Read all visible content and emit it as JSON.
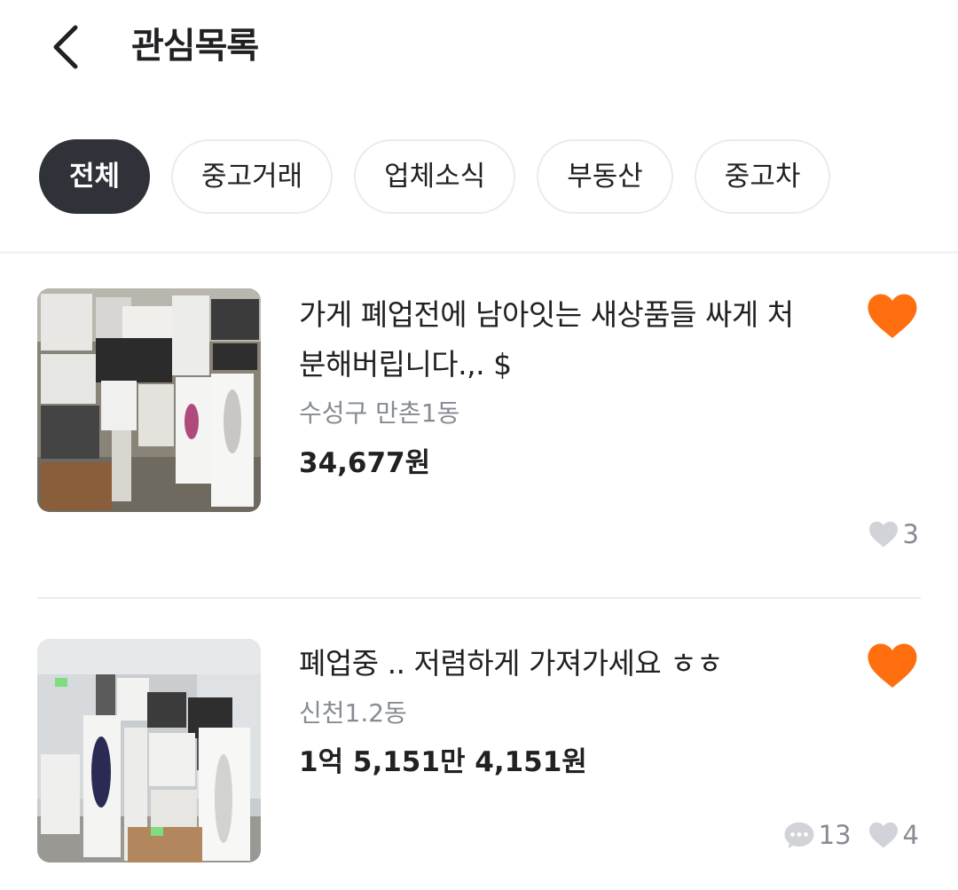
{
  "header": {
    "title": "관심목록",
    "back_icon": "chevron-left-icon"
  },
  "filters": [
    {
      "label": "전체",
      "active": true
    },
    {
      "label": "중고거래",
      "active": false
    },
    {
      "label": "업체소식",
      "active": false
    },
    {
      "label": "부동산",
      "active": false
    },
    {
      "label": "중고차",
      "active": false
    }
  ],
  "items": [
    {
      "title": "가게 폐업전에 남아잇는 새상품들 싸게 처분해버립니다.,. $",
      "location": "수성구 만촌1동",
      "price": "34,677원",
      "liked": true,
      "comments": null,
      "likes": "3"
    },
    {
      "title": "폐업중 .. 저렴하게 가져가세요 ㅎㅎ",
      "location": "신천1.2동",
      "price": "1억 5,151만 4,151원",
      "liked": true,
      "comments": "13",
      "likes": "4"
    }
  ],
  "colors": {
    "accent": "#ff6f0f",
    "chip_active_bg": "#2f3238",
    "muted_text": "#868b94",
    "stat_icon": "#d1d3d8"
  }
}
